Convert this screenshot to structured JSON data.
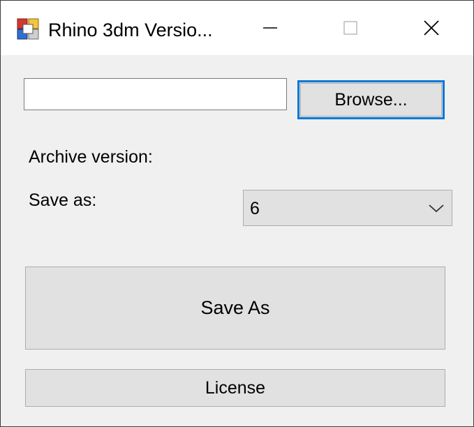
{
  "window": {
    "title": "Rhino 3dm Versio..."
  },
  "icons": {
    "app": "rhino-app-icon",
    "minimize": "minimize-icon",
    "maximize": "maximize-icon",
    "close": "close-icon",
    "dropdown": "chevron-down-icon"
  },
  "form": {
    "path_value": "",
    "browse_label": "Browse...",
    "archive_version_label": "Archive version:",
    "save_as_label": "Save as:",
    "save_as_selected": "6",
    "save_as_button_label": "Save As",
    "license_button_label": "License"
  },
  "colors": {
    "focus_accent": "#0078d7",
    "button_face": "#e1e1e1",
    "window_background": "#f0f0f0"
  }
}
